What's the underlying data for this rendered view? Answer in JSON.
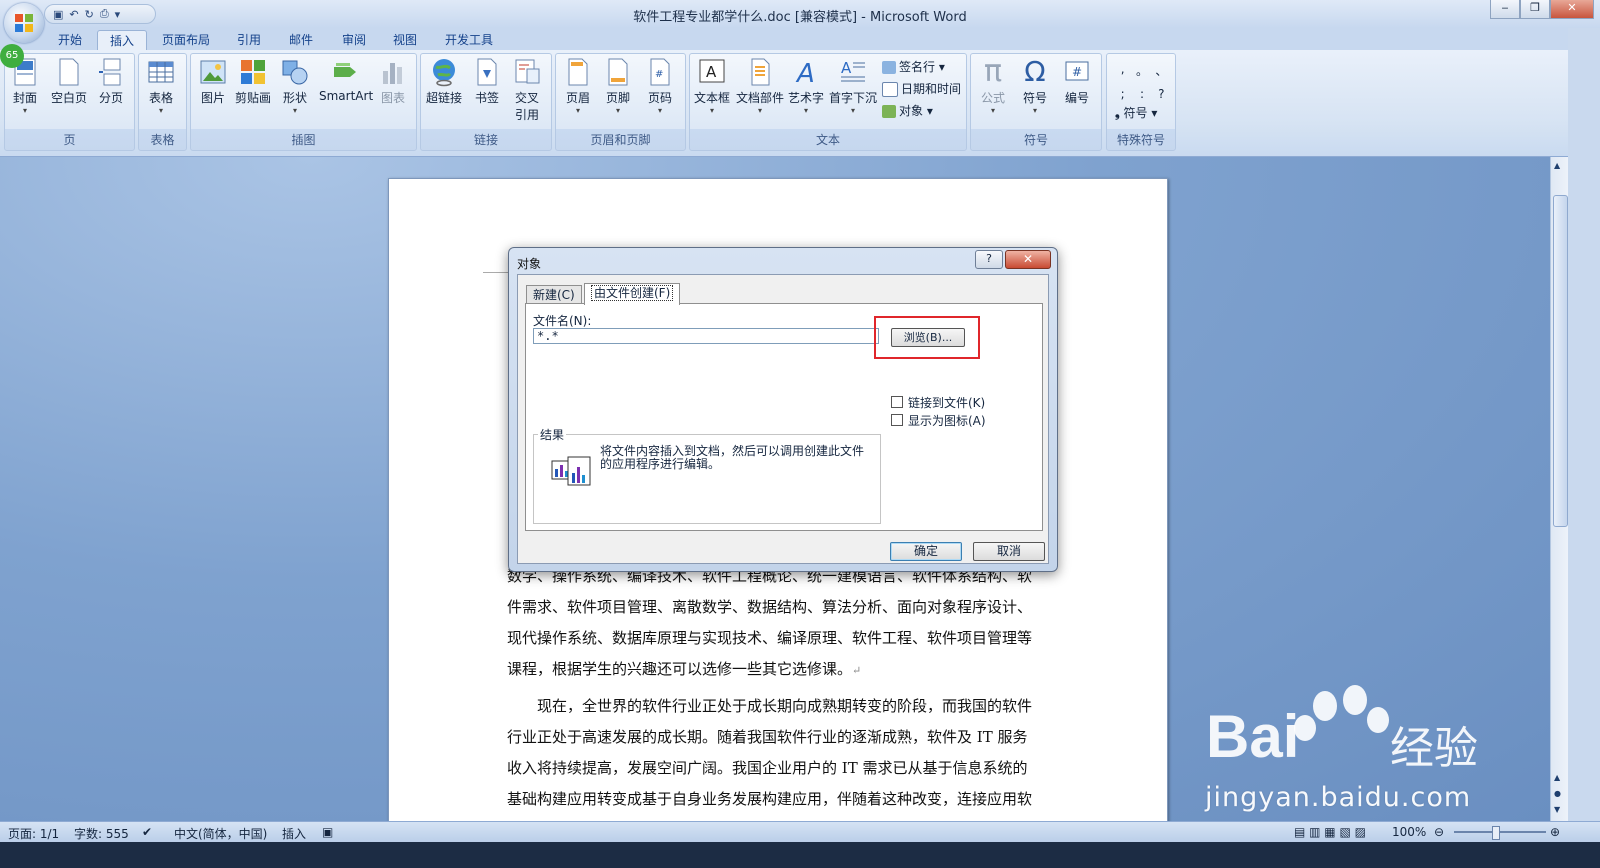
{
  "window": {
    "title": "软件工程专业都学什么.doc [兼容模式] - Microsoft Word",
    "badge": "65",
    "controls": {
      "minimize": "‒",
      "maximize": "❐",
      "close": "✕"
    }
  },
  "qat": {
    "save": "▣",
    "undo": "↶",
    "redo": "↻",
    "print": "⎙",
    "more": "▾"
  },
  "tabs": [
    "开始",
    "插入",
    "页面布局",
    "引用",
    "邮件",
    "审阅",
    "视图",
    "开发工具"
  ],
  "active_tab": "插入",
  "ribbon": {
    "groups": {
      "page": "页",
      "table": "表格",
      "illustrations": "插图",
      "links": "链接",
      "header_footer": "页眉和页脚",
      "text": "文本",
      "symbols": "符号",
      "special": "特殊符号"
    },
    "buttons": {
      "cover": "封面",
      "blank_page": "空白页",
      "page_break": "分页",
      "table": "表格",
      "picture": "图片",
      "clipart": "剪贴画",
      "shapes": "形状",
      "smartart": "SmartArt",
      "chart": "图表",
      "hyperlink": "超链接",
      "bookmark": "书签",
      "cross_ref_1": "交叉",
      "cross_ref_2": "引用",
      "header": "页眉",
      "footer": "页脚",
      "page_number": "页码",
      "textbox": "文本框",
      "quick_parts": "文档部件",
      "wordart": "艺术字",
      "dropcap": "首字下沉",
      "signature": "签名行",
      "datetime": "日期和时间",
      "object": "对象",
      "equation": "公式",
      "symbol": "符号",
      "number": "编号",
      "special_symbol": "符号"
    },
    "special_chars": [
      ",",
      "。",
      "、",
      ";",
      ":",
      "?"
    ],
    "icon_glyphs": {
      "equation": "π",
      "symbol": "Ω",
      "number": "#",
      "wordart": "A",
      "textbox": "A"
    }
  },
  "document": {
    "lines": [
      "数学、操作系统、编译技术、软件工程概论、统一建模语言、软件体系结构、软",
      "件需求、软件项目管理、离散数学、数据结构、算法分析、面向对象程序设计、",
      "现代操作系统、数据库原理与实现技术、编译原理、软件工程、软件项目管理等",
      "课程，根据学生的兴趣还可以选修一些其它选修课。"
    ],
    "lines2": [
      "　　现在，全世界的软件行业正处于成长期向成熟期转变的阶段，而我国的软件",
      "行业正处于高速发展的成长期。随着我国软件行业的逐渐成熟，软件及 IT 服务",
      "收入将持续提高，发展空间广阔。我国企业用户的 IT 需求已从基于信息系统的",
      "基础构建应用转变成基于自身业务发展构建应用，伴随着这种改变，连接应用软"
    ],
    "para_mark": "↵"
  },
  "dialog": {
    "title": "对象",
    "help": "?",
    "close": "✕",
    "tabs": {
      "new": "新建(C)",
      "from_file": "由文件创建(F)"
    },
    "file_name_label": "文件名(N):",
    "file_name_value": "*.*",
    "browse": "浏览(B)...",
    "link_to_file": "链接到文件(K)",
    "display_as_icon": "显示为图标(A)",
    "result_label": "结果",
    "result_text": "将文件内容插入到文档，然后可以调用创建此文件的应用程序进行编辑。",
    "ok": "确定",
    "cancel": "取消"
  },
  "status": {
    "page": "页面: 1/1",
    "words": "字数: 555",
    "language": "中文(简体，中国)",
    "mode": "插入",
    "zoom": "100%"
  },
  "watermark": {
    "brand": "Bai",
    "jingyan": "经验",
    "url": "jingyan.baidu.com"
  },
  "colors": {
    "accent": "#15428b",
    "highlight": "#e0262b",
    "ribbon": "#d6e3f3"
  }
}
